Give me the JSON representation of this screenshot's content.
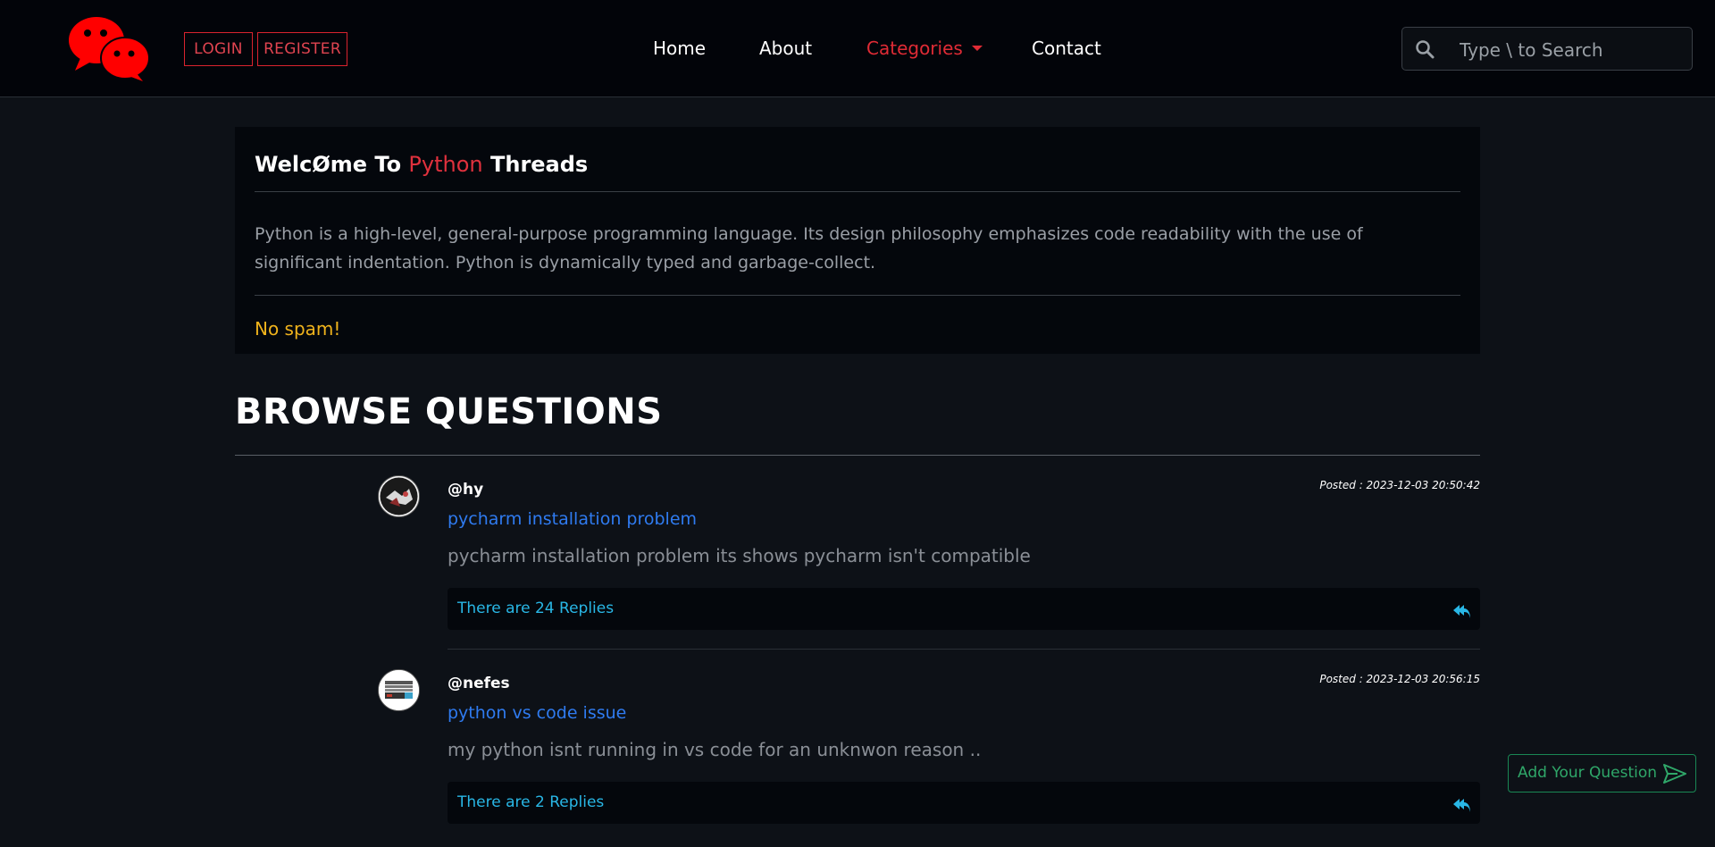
{
  "auth": {
    "login": "LOGIN",
    "register": "REGISTER"
  },
  "nav": {
    "home": "Home",
    "about": "About",
    "categories": "Categories",
    "contact": "Contact"
  },
  "search": {
    "placeholder": "Type \\ to Search"
  },
  "welcome": {
    "title_pre": "WelcØme To ",
    "title_accent": "Python",
    "title_post": " Threads",
    "description": "Python is a high-level, general-purpose programming language. Its design philosophy emphasizes code readability with the use of significant indentation. Python is dynamically typed and garbage-collect.",
    "notice": "No spam!"
  },
  "browse": {
    "title": "BROWSE QUESTIONS"
  },
  "questions": [
    {
      "user": "@hy",
      "posted": "Posted : 2023-12-03 20:50:42",
      "title": "pycharm installation problem",
      "description": "pycharm installation problem its shows pycharm isn't compatible",
      "replies": "There are 24 Replies"
    },
    {
      "user": "@nefes",
      "posted": "Posted : 2023-12-03 20:56:15",
      "title": "python vs code issue",
      "description": "my python isnt running in vs code for an unknwon reason ..",
      "replies": "There are 2 Replies"
    }
  ],
  "add_question": {
    "label": "Add Your Question"
  },
  "icons": {
    "logo": "chat-bubbles-logo",
    "search": "search-icon",
    "reply": "reply-all-icon",
    "send": "send-icon"
  },
  "colors": {
    "accent_red": "#e02b35",
    "link_blue": "#2f7bf0",
    "reply_cyan": "#29b7e6",
    "notice_yellow": "#f0b31c",
    "success_green": "#198754"
  }
}
